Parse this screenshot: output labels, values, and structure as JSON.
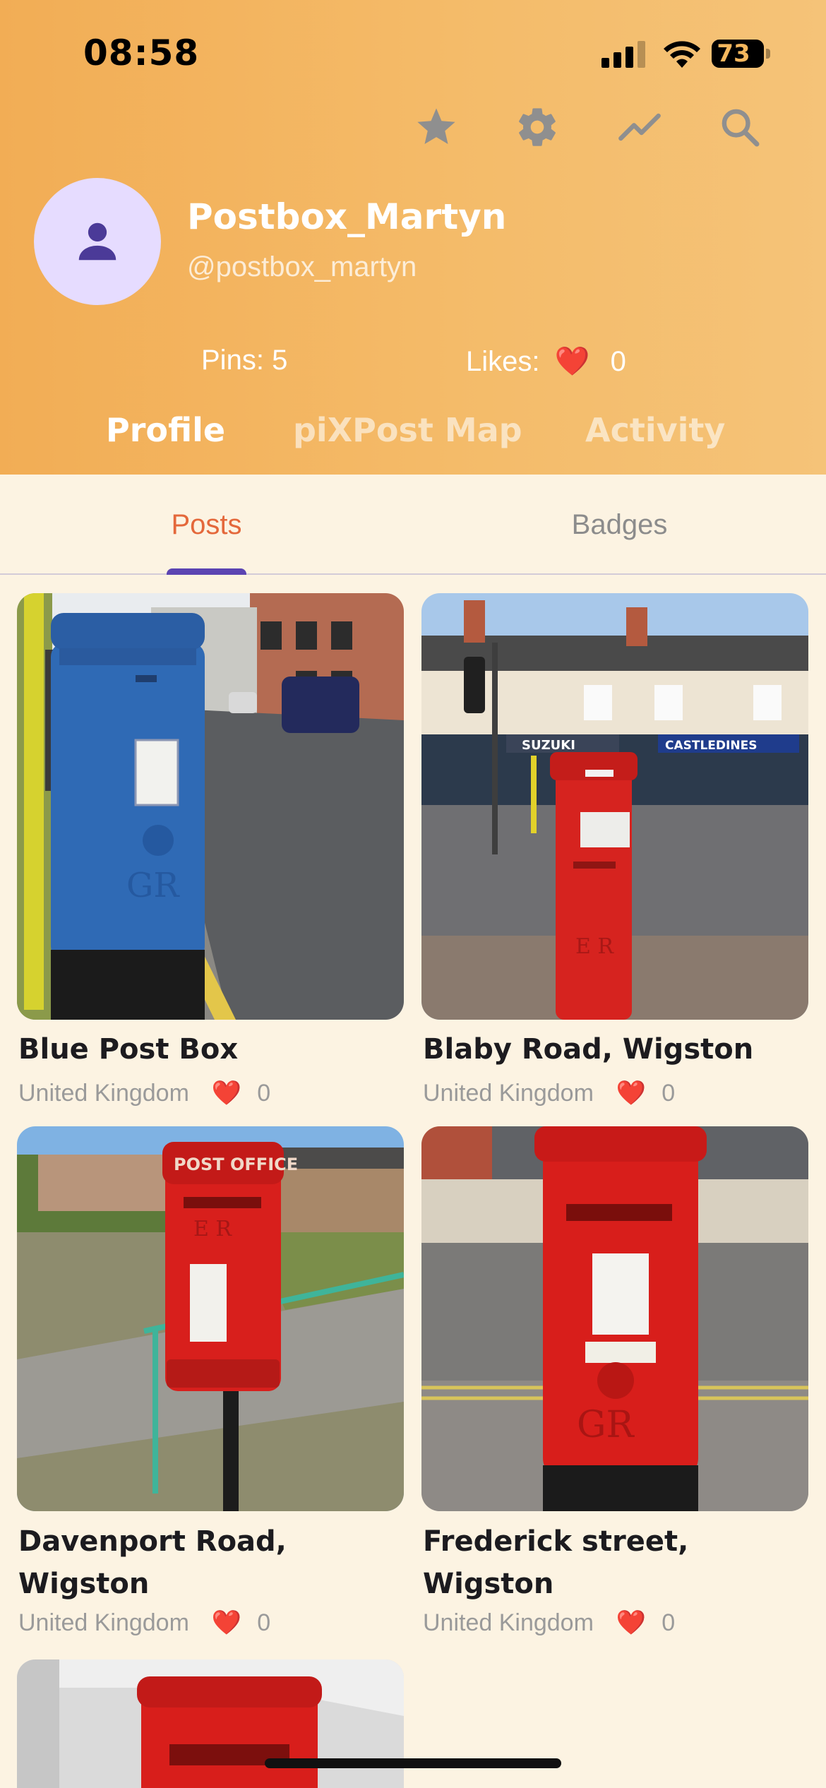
{
  "status_bar": {
    "time": "08:58",
    "battery": "73",
    "battery_level": 0.73
  },
  "toolbar": {
    "icons": [
      "star-icon",
      "gear-icon",
      "trending-icon",
      "search-icon"
    ]
  },
  "profile": {
    "display_name": "Postbox_Martyn",
    "username": "@postbox_martyn",
    "pins_label": "Pins:",
    "pins_count": "5",
    "likes_label": "Likes:",
    "likes_heart": "❤️",
    "likes_count": "0"
  },
  "nav_tabs": [
    {
      "label": "Profile",
      "active": true
    },
    {
      "label": "piXPost Map",
      "active": false
    },
    {
      "label": "Activity",
      "active": false
    }
  ],
  "sub_tabs": [
    {
      "label": "Posts",
      "active": true
    },
    {
      "label": "Badges",
      "active": false
    }
  ],
  "posts": [
    {
      "title": "Blue Post Box",
      "country": "United Kingdom",
      "heart": "❤️",
      "likes": "0"
    },
    {
      "title": "Blaby Road, Wigston",
      "country": "United Kingdom",
      "heart": "❤️",
      "likes": "0"
    },
    {
      "title": "Davenport Road, Wigston",
      "country": "United Kingdom",
      "heart": "❤️",
      "likes": "0"
    },
    {
      "title": "Frederick street, Wigston",
      "country": "United Kingdom",
      "heart": "❤️",
      "likes": "0"
    },
    {
      "title": "",
      "country": "",
      "heart": "",
      "likes": ""
    }
  ],
  "colors": {
    "header_gradient_start": "#f2ad55",
    "header_gradient_end": "#f5c378",
    "background": "#fcf3e2",
    "active_subtab": "#e4683b",
    "indicator": "#5b44b2",
    "avatar_bg": "#e6dcff",
    "avatar_icon": "#4b3a98",
    "toolbar_icon": "#8f8f8f"
  }
}
